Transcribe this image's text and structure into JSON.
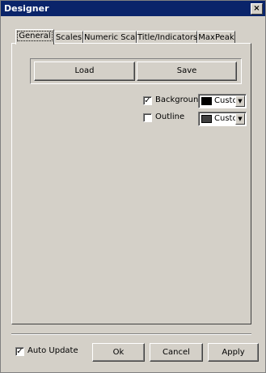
{
  "window": {
    "title": "Designer",
    "close_glyph": "×"
  },
  "tabs": [
    {
      "label": "General",
      "active": true
    },
    {
      "label": "Scales"
    },
    {
      "label": "Numeric Scale"
    },
    {
      "label": "Title/Indicators"
    },
    {
      "label": "MaxPeak"
    }
  ],
  "general": {
    "load_label": "Load",
    "save_label": "Save",
    "background": {
      "checked": true,
      "label": "Backgrounc",
      "color_text": "Custo",
      "swatch": "#000000"
    },
    "outline": {
      "checked": false,
      "label": "Outline",
      "color_text": "Custo",
      "swatch": "#404040"
    }
  },
  "footer": {
    "auto_update": {
      "checked": true,
      "label": "Auto Update"
    },
    "ok_label": "Ok",
    "cancel_label": "Cancel",
    "apply_label": "Apply"
  },
  "colors": {
    "titlebar": "#0a246a",
    "face": "#d4d0c8"
  },
  "icons": {
    "dropdown": "▼",
    "check": "✓"
  }
}
